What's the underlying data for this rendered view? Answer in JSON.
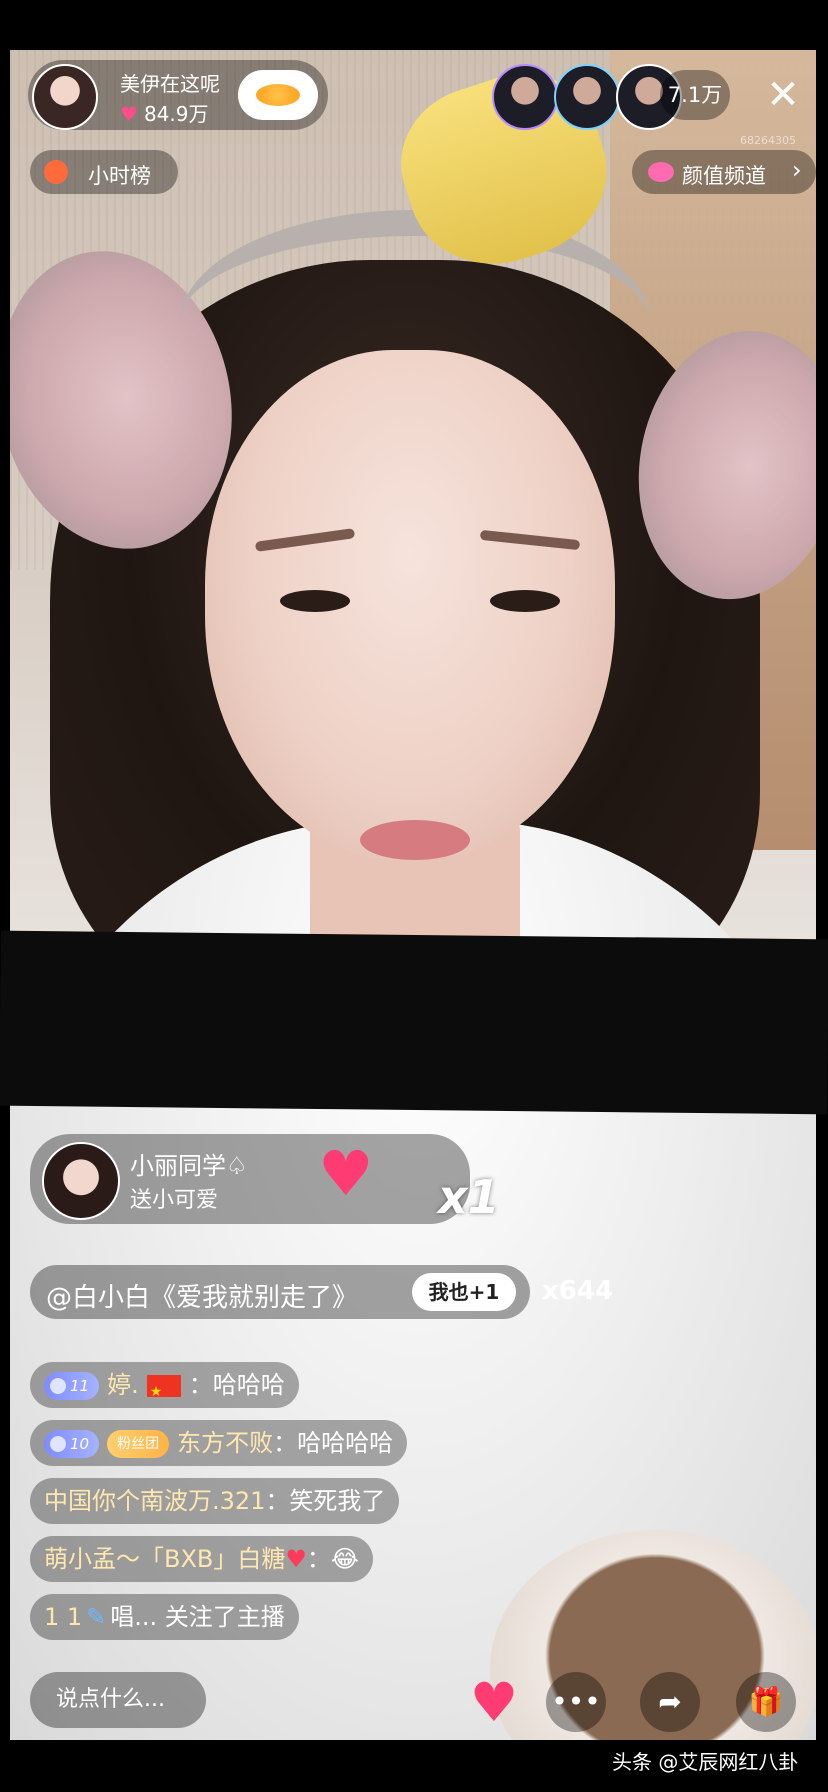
{
  "host": {
    "name": "美伊在这呢",
    "likes": "84.9万",
    "icon": "heart-icon"
  },
  "rank": {
    "label": "小时榜"
  },
  "viewers": {
    "count": "7.1万"
  },
  "close": {
    "symbol": "✕"
  },
  "channel": {
    "label": "颜值频道",
    "chevron": "›"
  },
  "uid": {
    "value": "68264305"
  },
  "gift": {
    "user": "小丽同学♤",
    "message": "送小可爱",
    "count": "x1"
  },
  "song": {
    "text": "@白小白《爱我就别走了》",
    "me_too": "我也+1",
    "count": "x644"
  },
  "chat": [
    {
      "level": "11",
      "user": "婷.",
      "text": "：哈哈哈"
    },
    {
      "level": "10",
      "fan": "粉丝团",
      "user": "东方不败",
      "text": "：哈哈哈哈"
    },
    {
      "user": "中国你个南波万.321",
      "text": "：笑死我了"
    },
    {
      "user": "萌小孟～「BXB」白糖",
      "text": "：😂"
    },
    {
      "user": "1 1",
      "text": "唱... 关注了主播"
    }
  ],
  "input": {
    "placeholder": "说点什么..."
  },
  "actions": {
    "more": "•••",
    "share": "➦",
    "gift": "🎁"
  },
  "watermark": "头条 @艾辰网红八卦"
}
